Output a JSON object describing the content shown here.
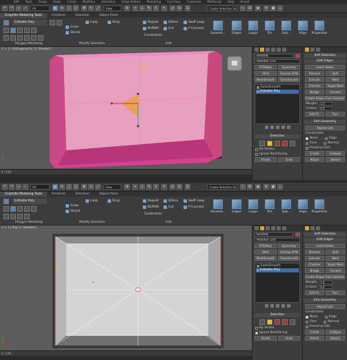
{
  "menu": [
    "Edit",
    "Tools",
    "Group",
    "Views",
    "Create",
    "Modifiers",
    "Animation",
    "Graph Editors",
    "Rendering",
    "Civil View",
    "Customize",
    "MAXScript",
    "Help",
    "Arnold"
  ],
  "toolbar": {
    "filter": "All",
    "view": "View",
    "selset": "Create Selection Se"
  },
  "ribbon": {
    "tabs": [
      "Graphite Modeling Tools",
      "Freeform",
      "Selection",
      "Object Paint"
    ],
    "mode": "Editable Poly",
    "grow": "Grow",
    "shrink": "Shrink",
    "loop": "Loop",
    "ring": "Ring",
    "repeat": "Repeat",
    "qslice": "QSlice",
    "swiftloop": "Swift Loop",
    "nurms": "NURMS",
    "cut": "Cut",
    "pconnect": "P Connect",
    "constraints": "Constraints",
    "big": [
      "Geomet...",
      "Edges",
      "Loops",
      "Tris",
      "Sub...",
      "Align",
      "Properties"
    ],
    "groups": [
      "Polygon Modeling",
      "Modify Selection",
      "Edit"
    ]
  },
  "viewport1": {
    "label": "[ + ] [ Orthographic ] [ Shaded ]"
  },
  "viewport2": {
    "label": "[ + ] [ Top ] [ Shaded ]"
  },
  "timeline": "0 / 100",
  "cmd": {
    "object": "Box006",
    "modlist": "Modifier List",
    "btns1": [
      "FFD(Box)",
      "Symmetry"
    ],
    "btns2": [
      "Shell",
      "Unwrap UVW"
    ],
    "btns3": [
      "MeshSmooth",
      "TurboSmooth"
    ],
    "stack": [
      "TurboSmooth",
      "Editable Poly"
    ],
    "selhdr": "Selection",
    "byvertex": "By Vertex",
    "ignore": "Ignore Backfacing",
    "shrink": "Shrink",
    "grow": "Grow"
  },
  "side": {
    "softsel": "Soft Selection",
    "editedges": "Edit Edges",
    "insertvertex": "Insert Vertex",
    "remove": "Remove",
    "split": "Split",
    "extrude": "Extrude",
    "weld": "Weld",
    "chamfer": "Chamfer",
    "targetweld": "Target Weld",
    "bridge": "Bridge",
    "connect": "Connect",
    "createshape": "Create Shape From Selection",
    "weight": "Weight:",
    "crease": "Crease:",
    "weightval": "1.0",
    "creaseval": "0.0",
    "edittri": "Edit Tri.",
    "turn": "Turn",
    "editgeom": "Edit Geometry",
    "repeatlast": "Repeat Last",
    "constraints": "Constraints",
    "none": "None",
    "edge": "Edge",
    "face": "Face",
    "normal": "Normal",
    "preserve": "Preserve UVs",
    "create": "Create",
    "collapse": "Collapse",
    "attach": "Attach",
    "detach": "Detach"
  }
}
